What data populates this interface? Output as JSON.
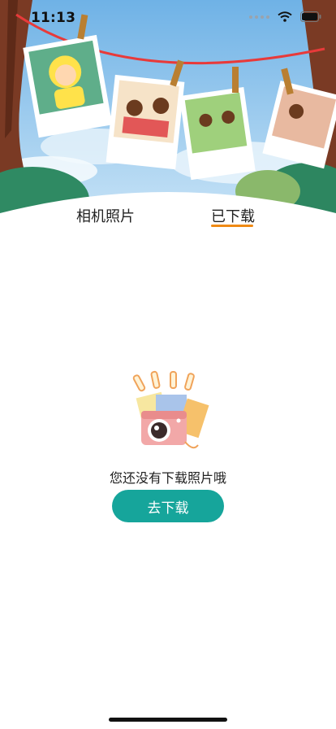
{
  "status_bar": {
    "time": "11:13"
  },
  "tabs": [
    {
      "label": "相机照片",
      "active": false
    },
    {
      "label": "已下载",
      "active": true
    }
  ],
  "empty_state": {
    "message": "您还没有下载照片哦",
    "button_label": "去下载"
  },
  "colors": {
    "accent": "#16a59b",
    "tab_indicator": "#f08a14",
    "sky": "#7fbce8"
  }
}
